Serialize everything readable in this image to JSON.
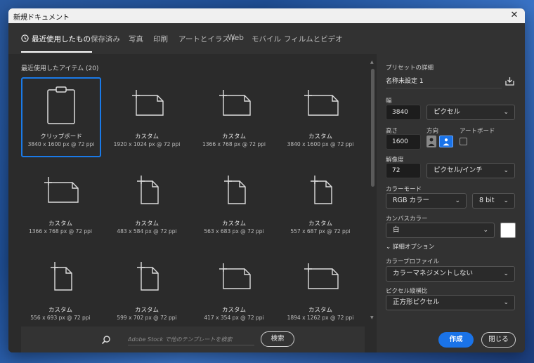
{
  "window": {
    "title": "新規ドキュメント",
    "close": "✕"
  },
  "tabs": [
    "最近使用したもの",
    "保存済み",
    "写真",
    "印刷",
    "アートとイラスト",
    "Web",
    "モバイル",
    "フィルムとビデオ"
  ],
  "recent": {
    "title": "最近使用したアイテム (20)",
    "items": [
      {
        "name": "クリップボード",
        "size": "3840 x 1600 px @ 72 ppi"
      },
      {
        "name": "カスタム",
        "size": "1920 x 1024 px @ 72 ppi"
      },
      {
        "name": "カスタム",
        "size": "1366 x 768 px @ 72 ppi"
      },
      {
        "name": "カスタム",
        "size": "3840 x 1600 px @ 72 ppi"
      },
      {
        "name": "カスタム",
        "size": "1366 x 768 px @ 72 ppi"
      },
      {
        "name": "カスタム",
        "size": "483 x 584 px @ 72 ppi"
      },
      {
        "name": "カスタム",
        "size": "563 x 683 px @ 72 ppi"
      },
      {
        "name": "カスタム",
        "size": "557 x 687 px @ 72 ppi"
      },
      {
        "name": "カスタム",
        "size": "556 x 693 px @ 72 ppi"
      },
      {
        "name": "カスタム",
        "size": "599 x 702 px @ 72 ppi"
      },
      {
        "name": "カスタム",
        "size": "417 x 354 px @ 72 ppi"
      },
      {
        "name": "カスタム",
        "size": "1894 x 1262 px @ 72 ppi"
      }
    ]
  },
  "search": {
    "placeholder": "Adobe Stock で他のテンプレートを検索",
    "button": "検索"
  },
  "preset": {
    "title": "プリセットの詳細",
    "name": "名称未設定 1",
    "width_label": "幅",
    "width": "3840",
    "width_unit": "ピクセル",
    "height_label": "高さ",
    "height": "1600",
    "orientation_label": "方向",
    "artboard_label": "アートボード",
    "resolution_label": "解像度",
    "resolution": "72",
    "resolution_unit": "ピクセル/インチ",
    "color_mode_label": "カラーモード",
    "color_mode": "RGB カラー",
    "bit_depth": "8 bit",
    "canvas_color_label": "カンバスカラー",
    "canvas_color": "白",
    "canvas_swatch": "#ffffff",
    "advanced_label": "詳細オプション",
    "profile_label": "カラープロファイル",
    "profile": "カラーマネジメントしない",
    "aspect_label": "ピクセル縦横比",
    "aspect": "正方形ピクセル"
  },
  "buttons": {
    "create": "作成",
    "close": "閉じる"
  },
  "colors": {
    "accent": "#1a73e8",
    "selection": "#1a7ae8"
  },
  "icons": {
    "chevron": "⌄"
  }
}
